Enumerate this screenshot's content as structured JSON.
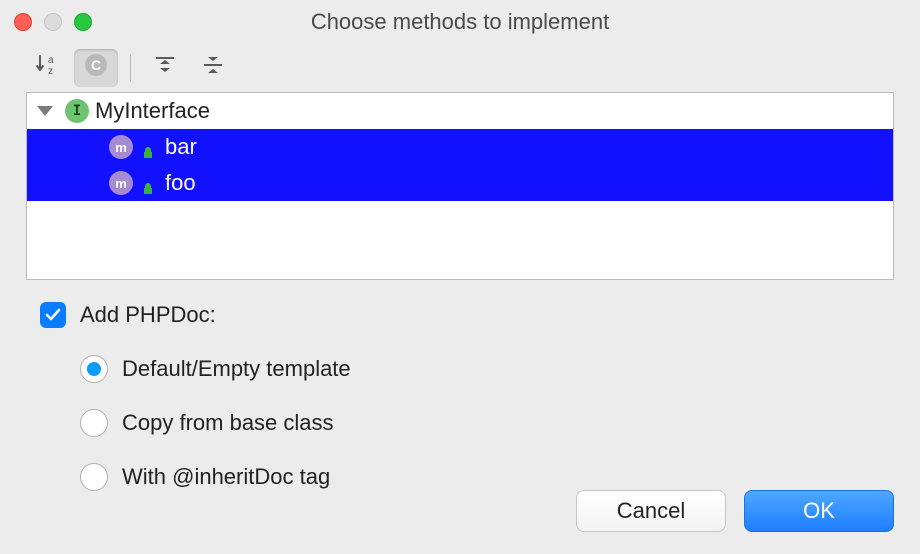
{
  "title": "Choose methods to implement",
  "toolbar": {
    "sort_tooltip": "Sort alphabetically",
    "show_classes_tooltip": "Show classes",
    "expand_all_tooltip": "Expand all",
    "collapse_all_tooltip": "Collapse all"
  },
  "tree": {
    "root": {
      "label": "MyInterface",
      "icon": "interface"
    },
    "children": [
      {
        "label": "bar",
        "icon": "method",
        "selected": true
      },
      {
        "label": "foo",
        "icon": "method",
        "selected": true
      }
    ]
  },
  "options": {
    "add_phpdoc_label": "Add PHPDoc:",
    "add_phpdoc_checked": true,
    "radio_selected": "default",
    "radios": {
      "default": "Default/Empty template",
      "copy": "Copy from base class",
      "inherit": "With @inheritDoc tag"
    }
  },
  "buttons": {
    "cancel": "Cancel",
    "ok": "OK"
  }
}
